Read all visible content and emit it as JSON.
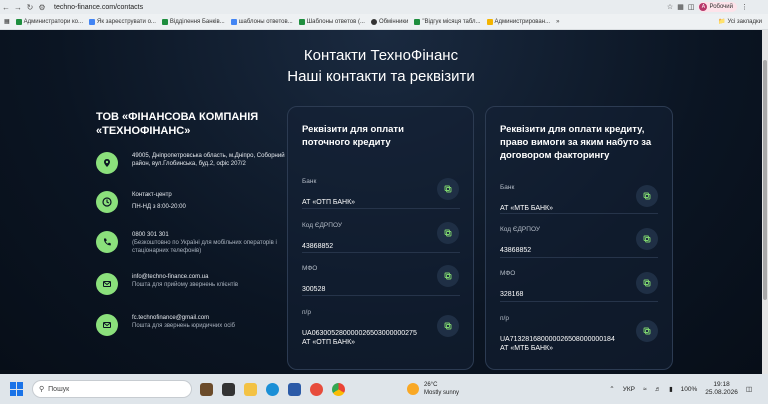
{
  "browser": {
    "url": "techno-finance.com/contacts",
    "profile_initial": "A",
    "profile_label": "Робочий",
    "bookmarks": [
      {
        "label": "Администратори ко...",
        "color": "g"
      },
      {
        "label": "Як зареєструвати о...",
        "color": "b"
      },
      {
        "label": "Відділення Банків...",
        "color": "g"
      },
      {
        "label": "шаблоны ответов...",
        "color": "b"
      },
      {
        "label": "Шаблоны ответов (...",
        "color": "g"
      },
      {
        "label": "Обмінники",
        "color": "k"
      },
      {
        "label": "\"Відгук місяця табл...",
        "color": "g"
      },
      {
        "label": "Администрирован...",
        "color": "o"
      }
    ],
    "all_bookmarks_label": "Усі закладки"
  },
  "page": {
    "title": "Контакти ТехноФінанс",
    "subtitle": "Наші контакти та реквізити",
    "company_name": "ТОВ «ФІНАНСОВА КОМПАНІЯ «ТЕХНОФІНАНС»",
    "contacts": [
      {
        "icon": "location-pin-icon",
        "line1": "49005, Дніпропетровська область, м.Дніпро, Соборний район, вул.Глобинська, буд.2, офіс 207/2",
        "line2": ""
      },
      {
        "icon": "clock-icon",
        "line1": "Контакт-центр",
        "line2": "ПН-НД з 8:00-20:00"
      },
      {
        "icon": "phone-icon",
        "line1": "0800 301 301",
        "line2": "(Безкоштовно по Україні для мобільних операторів і стаціонарних телефонів)"
      },
      {
        "icon": "mail-icon",
        "line1": "info@techno-finance.com.ua",
        "line2": "Пошта для прийому звернень клієнтів"
      },
      {
        "icon": "mail-icon",
        "line1": "fc.technofinance@gmail.com",
        "line2": "Пошта для звернень юридичних осіб"
      }
    ],
    "card1": {
      "title": "Реквізити для оплати поточного кредиту",
      "fields": [
        {
          "label": "Банк",
          "value": "АТ «ОТП БАНК»"
        },
        {
          "label": "Код ЄДРПОУ",
          "value": "43868852"
        },
        {
          "label": "МФО",
          "value": "300528"
        },
        {
          "label": "п/р",
          "value": "UA063005280000026503000000275",
          "value2": "АТ «ОТП БАНК»"
        }
      ]
    },
    "card2": {
      "title": "Реквізити для оплати кредиту, право вимоги за яким набуто за договором факторингу",
      "fields": [
        {
          "label": "Банк",
          "value": "АТ «МТБ БАНК»"
        },
        {
          "label": "Код ЄДРПОУ",
          "value": "43868852"
        },
        {
          "label": "МФО",
          "value": "328168"
        },
        {
          "label": "п/р",
          "value": "UA713281680000026508000000184",
          "value2": "АТ «МТБ БАНК»"
        }
      ]
    }
  },
  "taskbar": {
    "search_placeholder": "Пошук",
    "weather_temp": "26°C",
    "weather_desc": "Mostly sunny",
    "lang": "УКР",
    "battery": "100%",
    "time": "19:18",
    "date": "25.08.2026"
  },
  "colors": {
    "accent": "#8be07c",
    "background": "#0b1523"
  }
}
